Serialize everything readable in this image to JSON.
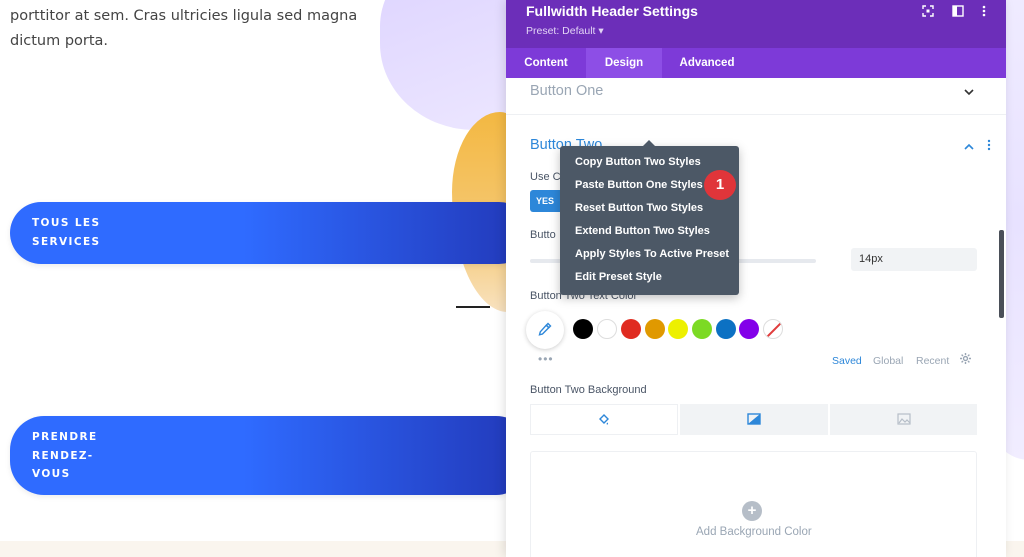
{
  "page": {
    "paragraph": "porttitor at sem. Cras ultricies ligula sed magna dictum porta.",
    "cta_1": "TOUS LES\nSERVICES",
    "cta_2": "PRENDRE\nRENDEZ-\nVOUS"
  },
  "modal": {
    "title": "Fullwidth Header Settings",
    "preset": "Preset: Default ▾",
    "header_icons": [
      "focus-icon",
      "sidebar-icon",
      "more-vertical-icon"
    ],
    "tabs": [
      {
        "label": "Content",
        "active": false
      },
      {
        "label": "Design",
        "active": true
      },
      {
        "label": "Advanced",
        "active": false
      }
    ],
    "sections": {
      "button_one": "Button One",
      "button_two": "Button Two"
    },
    "use_custom_label": "Use C",
    "toggle_value": "YES",
    "font_size_label": "Butto",
    "font_size_value": "14px",
    "text_color_label": "Button Two Text Color",
    "swatches": [
      "#000000",
      "#ffffff",
      "#e02b20",
      "#e09900",
      "#edf000",
      "#7cda24",
      "#0c71c3",
      "#8300e9",
      "none"
    ],
    "color_tabs": {
      "saved": "Saved",
      "global": "Global",
      "recent": "Recent"
    },
    "background_label": "Button Two Background",
    "background_tabs": [
      "paint-bucket-icon",
      "gradient-icon",
      "image-icon"
    ],
    "add_background": "Add Background Color",
    "accent_color": "#2d87d9",
    "header_color": "#6c2eb9"
  },
  "context_menu": {
    "items": [
      "Copy Button Two Styles",
      "Paste Button One Styles",
      "Reset Button Two Styles",
      "Extend Button Two Styles",
      "Apply Styles To Active Preset",
      "Edit Preset Style"
    ],
    "badge": "1"
  }
}
